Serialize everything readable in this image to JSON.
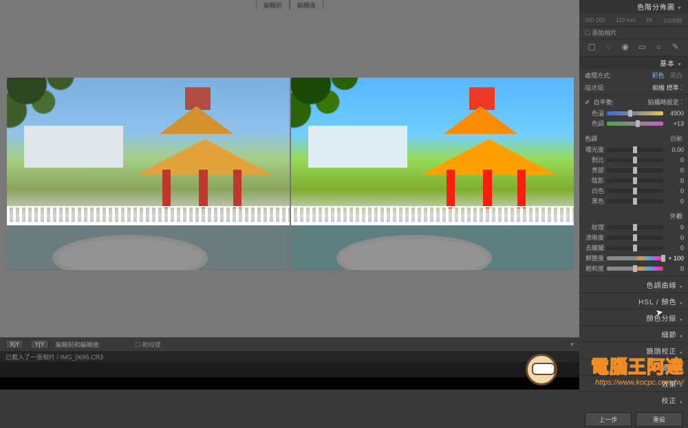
{
  "top_tabs": {
    "before": "編輯前",
    "after": "編輯後"
  },
  "bottom_toolbar": {
    "view_xy": "X|Y",
    "view_yy": "Y|Y",
    "label_before_after": "編輯前和編輯後:",
    "soft_proof": "軟校樣"
  },
  "status": {
    "loaded": "已載入了一張相片 /",
    "filename": "IMG_0695.CR3"
  },
  "panels": {
    "histogram_title": "色階分佈圖",
    "histo_info": {
      "iso": "ISO 200",
      "focal": "120 mm",
      "aperture": "f/9",
      "shutter": "1/320秒"
    },
    "original_photo": "原始相片",
    "basic_title": "基本",
    "treatment": {
      "label": "處理方式:",
      "color": "彩色",
      "bw": "黑白"
    },
    "profile": {
      "label": "描述檔:",
      "value": "相機 標準"
    },
    "wb": {
      "title": "白平衡:",
      "preset": "拍攝時設定",
      "temp_label": "色溫",
      "temp_value": "4900",
      "tint_label": "色調",
      "tint_value": "+13"
    },
    "tone": {
      "title": "色調",
      "auto": "自動",
      "exposure": "曝光度",
      "exposure_val": "0.00",
      "contrast": "對比",
      "contrast_val": "0",
      "highlights": "亮部",
      "highlights_val": "0",
      "shadows": "陰影",
      "shadows_val": "0",
      "whites": "白色",
      "whites_val": "0",
      "blacks": "黑色",
      "blacks_val": "0"
    },
    "presence": {
      "title": "外觀",
      "texture": "紋理",
      "texture_val": "0",
      "clarity": "清晰度",
      "clarity_val": "0",
      "dehaze": "去朦朧",
      "dehaze_val": "0",
      "vibrance": "鮮艷度",
      "vibrance_val": "+ 100",
      "saturation": "飽和度",
      "saturation_val": "0"
    },
    "collapsed": {
      "tone_curve": "色調曲線",
      "hsl": "HSL / 顏色",
      "color_grading": "顏色分級",
      "detail": "細節",
      "lens": "鏡頭校正",
      "transform": "變形",
      "effects": "效果",
      "calibration": "校正"
    },
    "bottom_buttons": {
      "prev": "上一步",
      "reset": "重設"
    }
  },
  "watermark": {
    "title": "電腦王阿達",
    "url": "https://www.kocpc.com.tw/"
  }
}
